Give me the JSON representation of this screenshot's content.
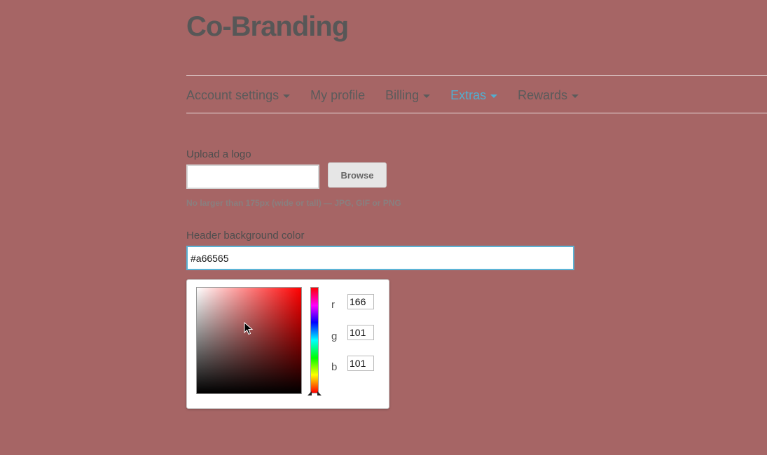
{
  "page": {
    "title": "Co-Branding"
  },
  "nav": {
    "items": [
      {
        "label": "Account settings",
        "dropdown": true,
        "active": false
      },
      {
        "label": "My profile",
        "dropdown": false,
        "active": false
      },
      {
        "label": "Billing",
        "dropdown": true,
        "active": false
      },
      {
        "label": "Extras",
        "dropdown": true,
        "active": true
      },
      {
        "label": "Rewards",
        "dropdown": true,
        "active": false
      }
    ]
  },
  "upload": {
    "label": "Upload a logo",
    "value": "",
    "browse_label": "Browse",
    "hint": "No larger than 175px (wide or tall) — JPG, GIF or PNG"
  },
  "header_color": {
    "label": "Header background color",
    "value": "#a66565"
  },
  "color_picker": {
    "r_label": "r",
    "g_label": "g",
    "b_label": "b",
    "r": "166",
    "g": "101",
    "b": "101"
  },
  "colors": {
    "background": "#a66565",
    "accent": "#52aed0",
    "text": "#5b5b5b"
  }
}
